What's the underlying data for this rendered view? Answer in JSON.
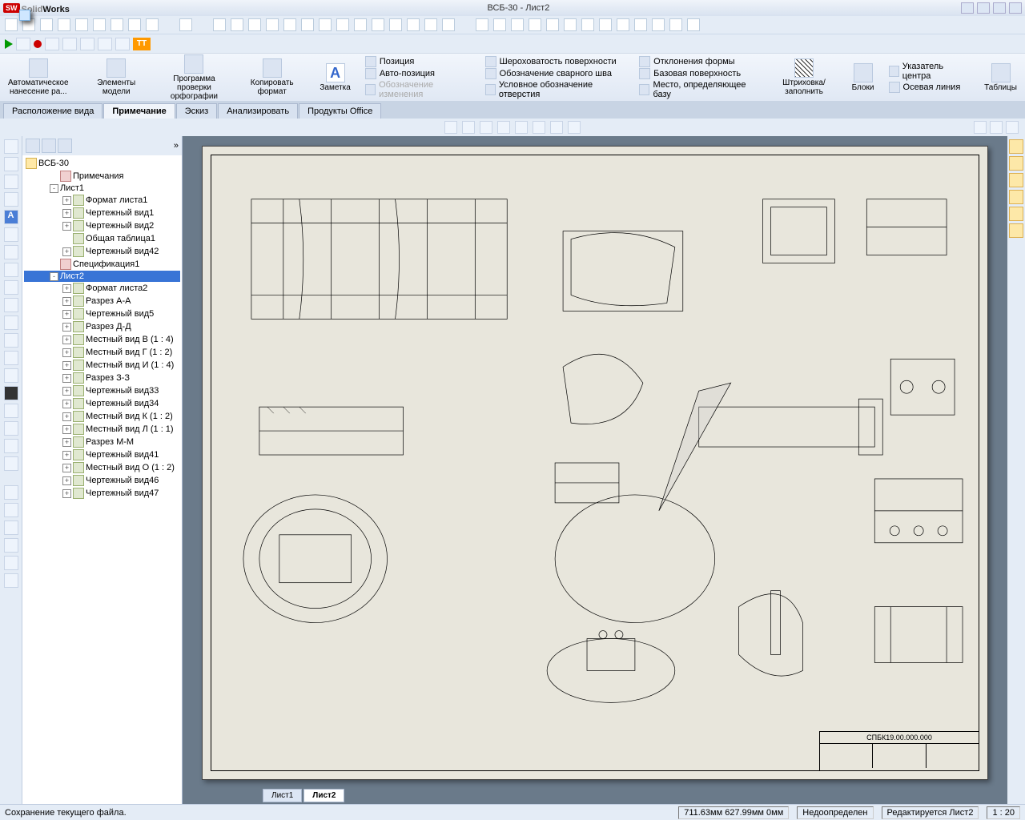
{
  "title": {
    "brand_solid": "Solid",
    "brand_works": "Works",
    "document": "ВСБ-30 - Лист2"
  },
  "tabs": [
    "Расположение вида",
    "Примечание",
    "Эскиз",
    "Анализировать",
    "Продукты Office"
  ],
  "active_tab": "Примечание",
  "ribbon": {
    "big": [
      {
        "label": "Автоматическое\nнанесение ра..."
      },
      {
        "label": "Элементы\nмодели"
      },
      {
        "label": "Программа\nпроверки\nорфографии"
      },
      {
        "label": "Копировать\nформат"
      },
      {
        "label": "Заметка"
      },
      {
        "label": "Штриховка/заполнить"
      },
      {
        "label": "Блоки"
      },
      {
        "label": "Таблицы"
      }
    ],
    "col1": [
      "Позиция",
      "Авто-позиция",
      "Обозначение изменения"
    ],
    "col2": [
      "Шероховатость поверхности",
      "Обозначение сварного шва",
      "Условное обозначение отверстия"
    ],
    "col3": [
      "Отклонения формы",
      "Базовая поверхность",
      "Место, определяющее базу"
    ],
    "col4": [
      "Указатель центра",
      "Осевая линия"
    ]
  },
  "tree": {
    "root": "ВСБ-30",
    "items": [
      {
        "d": 1,
        "t": "Примечания",
        "i": "spec"
      },
      {
        "d": 1,
        "t": "Лист1",
        "i": "sheet",
        "exp": "-"
      },
      {
        "d": 2,
        "t": "Формат листа1",
        "i": "view",
        "exp": "+"
      },
      {
        "d": 2,
        "t": "Чертежный вид1",
        "i": "view",
        "exp": "+"
      },
      {
        "d": 2,
        "t": "Чертежный вид2",
        "i": "view",
        "exp": "+"
      },
      {
        "d": 2,
        "t": "Общая таблица1",
        "i": "view"
      },
      {
        "d": 2,
        "t": "Чертежный вид42",
        "i": "view",
        "exp": "+"
      },
      {
        "d": 1,
        "t": "Спецификация1",
        "i": "spec"
      },
      {
        "d": 1,
        "t": "Лист2",
        "i": "sheet",
        "sel": true,
        "exp": "-"
      },
      {
        "d": 2,
        "t": "Формат листа2",
        "i": "view",
        "exp": "+"
      },
      {
        "d": 2,
        "t": "Разрез А-А",
        "i": "view",
        "exp": "+"
      },
      {
        "d": 2,
        "t": "Чертежный вид5",
        "i": "view",
        "exp": "+"
      },
      {
        "d": 2,
        "t": "Разрез Д-Д",
        "i": "view",
        "exp": "+"
      },
      {
        "d": 2,
        "t": "Местный вид В (1 : 4)",
        "i": "view",
        "exp": "+"
      },
      {
        "d": 2,
        "t": "Местный вид Г (1 : 2)",
        "i": "view",
        "exp": "+"
      },
      {
        "d": 2,
        "t": "Местный вид И (1 : 4)",
        "i": "view",
        "exp": "+"
      },
      {
        "d": 2,
        "t": "Разрез З-З",
        "i": "view",
        "exp": "+"
      },
      {
        "d": 2,
        "t": "Чертежный вид33",
        "i": "view",
        "exp": "+"
      },
      {
        "d": 2,
        "t": "Чертежный вид34",
        "i": "view",
        "exp": "+"
      },
      {
        "d": 2,
        "t": "Местный вид К (1 : 2)",
        "i": "view",
        "exp": "+"
      },
      {
        "d": 2,
        "t": "Местный вид Л (1 : 1)",
        "i": "view",
        "exp": "+"
      },
      {
        "d": 2,
        "t": "Разрез М-М",
        "i": "view",
        "exp": "+"
      },
      {
        "d": 2,
        "t": "Чертежный вид41",
        "i": "view",
        "exp": "+"
      },
      {
        "d": 2,
        "t": "Местный вид О (1 : 2)",
        "i": "view",
        "exp": "+"
      },
      {
        "d": 2,
        "t": "Чертежный вид46",
        "i": "view",
        "exp": "+"
      },
      {
        "d": 2,
        "t": "Чертежный вид47",
        "i": "view",
        "exp": "+"
      }
    ]
  },
  "drawing_number": "СПБК19.00.000.000",
  "sheet_tabs": [
    "Лист1",
    "Лист2"
  ],
  "active_sheet": "Лист2",
  "status": {
    "left": "Сохранение текущего файла.",
    "coords": "711.63мм   627.99мм   0мм",
    "state": "Недоопределен",
    "editing": "Редактируется Лист2",
    "scale": "1 : 20"
  }
}
